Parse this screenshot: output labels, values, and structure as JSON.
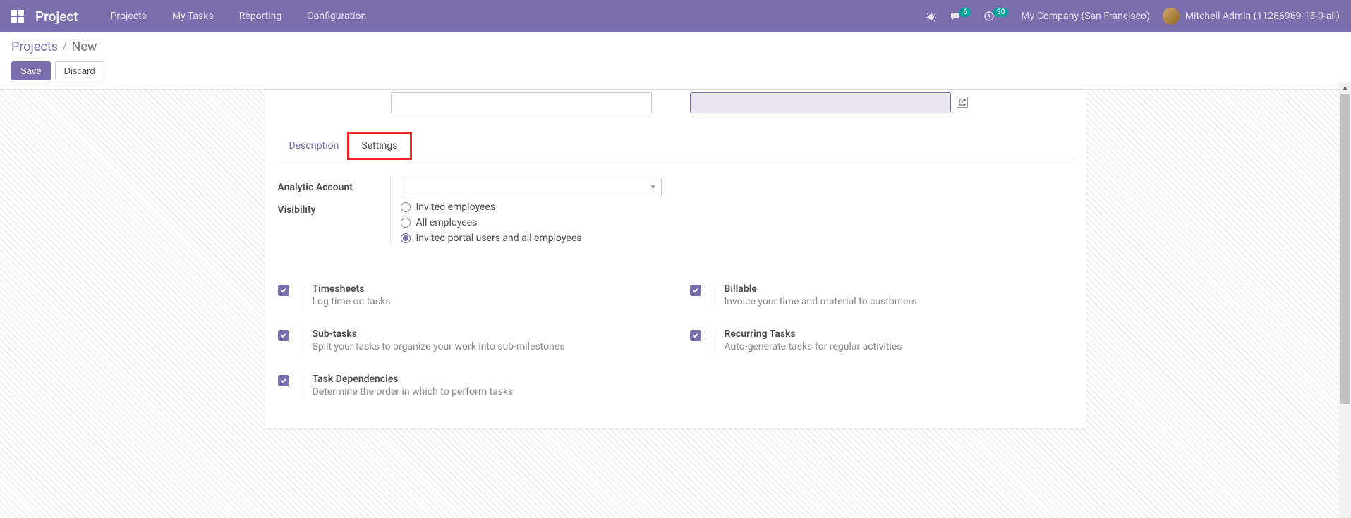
{
  "nav": {
    "brand": "Project",
    "menu": [
      "Projects",
      "My Tasks",
      "Reporting",
      "Configuration"
    ],
    "messages_count": "6",
    "activities_count": "30",
    "company": "My Company (San Francisco)",
    "user": "Mitchell Admin (11286969-15-0-all)"
  },
  "breadcrumb": {
    "parent": "Projects",
    "sep": "/",
    "current": "New"
  },
  "buttons": {
    "save": "Save",
    "discard": "Discard"
  },
  "tabs": {
    "description": "Description",
    "settings": "Settings"
  },
  "fields": {
    "analytic_account": "Analytic Account",
    "visibility": "Visibility"
  },
  "visibility_options": {
    "invited": "Invited employees",
    "all": "All employees",
    "portal": "Invited portal users and all employees"
  },
  "options": {
    "timesheets": {
      "title": "Timesheets",
      "desc": "Log time on tasks"
    },
    "billable": {
      "title": "Billable",
      "desc": "Invoice your time and material to customers"
    },
    "subtasks": {
      "title": "Sub-tasks",
      "desc": "Split your tasks to organize your work into sub-milestones"
    },
    "recurring": {
      "title": "Recurring Tasks",
      "desc": "Auto-generate tasks for regular activities"
    },
    "dependencies": {
      "title": "Task Dependencies",
      "desc": "Determine the order in which to perform tasks"
    }
  }
}
